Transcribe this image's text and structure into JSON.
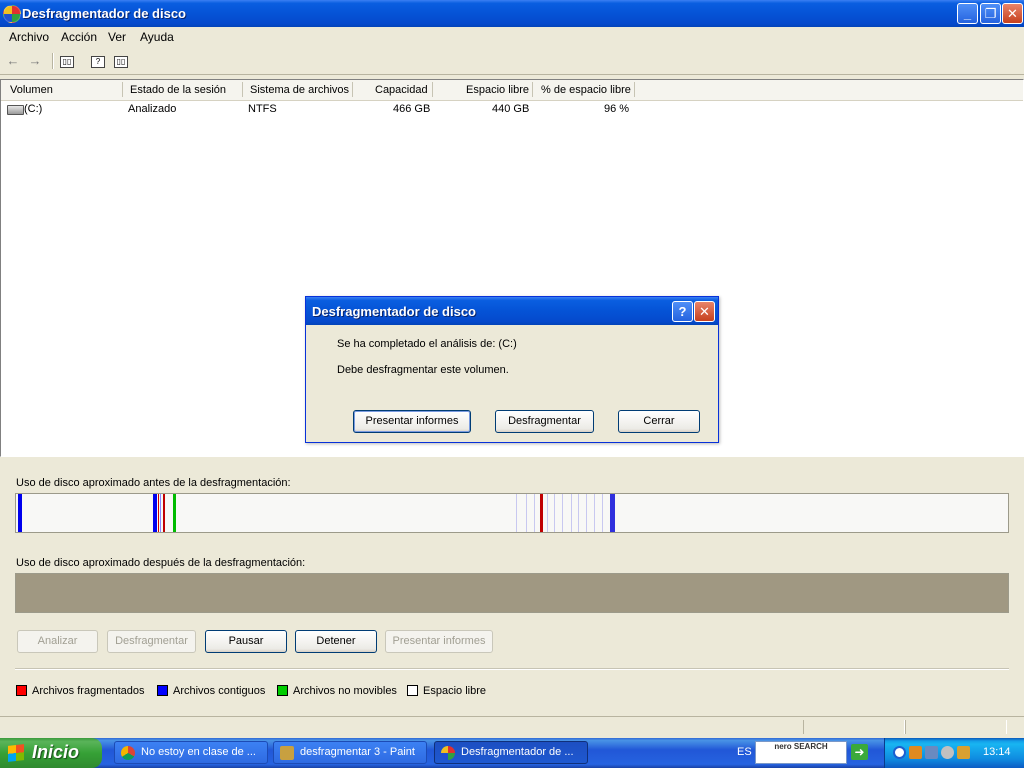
{
  "window": {
    "title": "Desfragmentador de disco"
  },
  "menu": [
    "Archivo",
    "Acción",
    "Ver",
    "Ayuda"
  ],
  "toolbar_icons": [
    "back-arrow-icon",
    "forward-arrow-icon",
    "show-hide-tree-icon",
    "properties-help-icon",
    "show-hide-panel-icon"
  ],
  "list": {
    "columns": [
      "Volumen",
      "Estado de la sesión",
      "Sistema de archivos",
      "Capacidad",
      "Espacio libre",
      "% de espacio libre"
    ],
    "rows": [
      {
        "volumen": "(C:)",
        "estado": "Analizado",
        "sistema": "NTFS",
        "capacidad": "466 GB",
        "libre": "440 GB",
        "porcentaje": "96 %"
      }
    ]
  },
  "panel": {
    "before_label": "Uso de disco aproximado antes de la desfragmentación:",
    "after_label": "Uso de disco aproximado después de la desfragmentación:",
    "buttons": {
      "analizar": "Analizar",
      "desfragmentar": "Desfragmentar",
      "pausar": "Pausar",
      "detener": "Detener",
      "presentar": "Presentar informes"
    },
    "legend": {
      "fragmentados": "Archivos fragmentados",
      "contiguos": "Archivos contiguos",
      "no_movibles": "Archivos no movibles",
      "libre": "Espacio libre"
    },
    "colors": {
      "fragmentados": "#ff0000",
      "contiguos": "#0000ff",
      "no_movibles": "#00cc00",
      "libre": "#ffffff"
    }
  },
  "dialog": {
    "title": "Desfragmentador de disco",
    "message1": "Se ha completado el análisis de: (C:)",
    "message2": "Debe desfragmentar este volumen.",
    "buttons": {
      "presentar": "Presentar informes",
      "desfragmentar": "Desfragmentar",
      "cerrar": "Cerrar"
    }
  },
  "taskbar": {
    "start": "Inicio",
    "tasks": [
      "No estoy en clase de ...",
      "desfragmentar 3 - Paint",
      "Desfragmentador de ..."
    ],
    "language": "ES",
    "nero_text": "nero SEARCH",
    "clock": "13:14"
  }
}
